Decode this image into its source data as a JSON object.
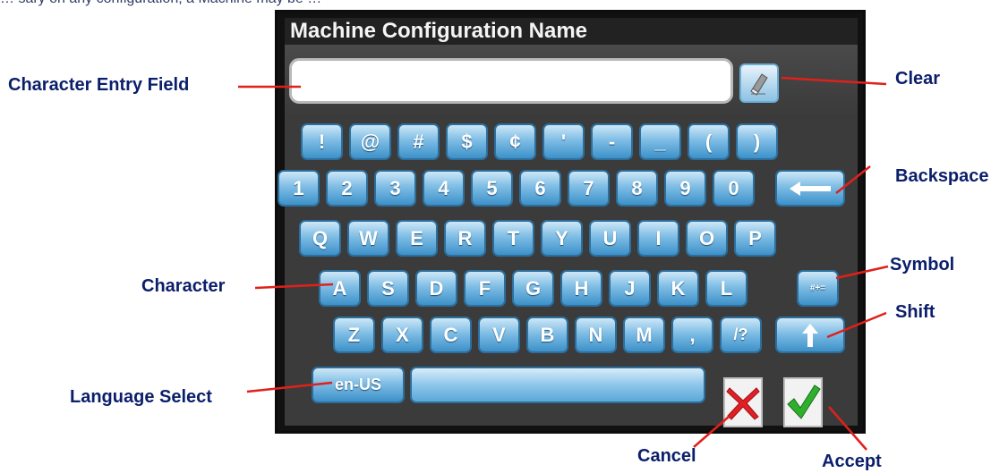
{
  "top_text": "… sary on any configuration, a Machine may be …",
  "dialog": {
    "title": "Machine Configuration Name",
    "entry_value": ""
  },
  "keyboard": {
    "row_symbols": [
      "!",
      "@",
      "#",
      "$",
      "¢",
      "'",
      "-",
      "_",
      "(",
      ")"
    ],
    "row_numbers": [
      "1",
      "2",
      "3",
      "4",
      "5",
      "6",
      "7",
      "8",
      "9",
      "0"
    ],
    "row_q": [
      "Q",
      "W",
      "E",
      "R",
      "T",
      "Y",
      "U",
      "I",
      "O",
      "P"
    ],
    "row_a": [
      "A",
      "S",
      "D",
      "F",
      "G",
      "H",
      "J",
      "K",
      "L"
    ],
    "row_z": [
      "Z",
      "X",
      "C",
      "V",
      "B",
      "N",
      "M",
      ",",
      "/?"
    ],
    "symbol_key": "#+=",
    "language_key": "en-US"
  },
  "callouts": {
    "entry_field": "Character Entry Field",
    "clear": "Clear",
    "backspace": "Backspace",
    "character": "Character",
    "symbol": "Symbol",
    "shift": "Shift",
    "language_select": "Language Select",
    "cancel": "Cancel",
    "accept": "Accept"
  },
  "colors": {
    "callout_text": "#0b1e6b",
    "callout_line": "#e0201b",
    "key_blue": "#3d91c9",
    "panel_dark": "#111111"
  },
  "icons": {
    "clear": "eraser-icon",
    "backspace": "left-arrow-icon",
    "shift": "up-arrow-icon",
    "cancel": "red-x-icon",
    "accept": "green-check-icon"
  }
}
